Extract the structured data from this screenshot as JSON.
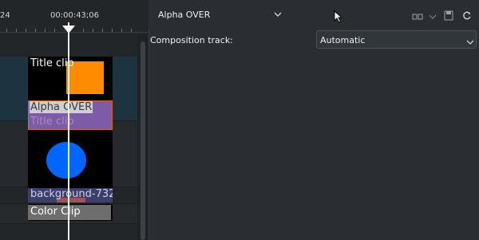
{
  "timeline": {
    "ruler_left": "24",
    "ruler_timecode": "00:00:43;06",
    "clips": {
      "title_top": "Title clip",
      "alpha_over": "Alpha OVER",
      "title_ghost": "Title clip",
      "background": "background-732",
      "color_clip": "Color Clip"
    }
  },
  "panel": {
    "header_title": "Alpha OVER",
    "composition_label": "Composition track:",
    "composition_value": "Automatic",
    "icons": [
      "compare-icon",
      "chevron-down-icon",
      "save-icon",
      "reset-icon"
    ]
  },
  "colors": {
    "accent_orange": "#ff8c00",
    "alpha_purple": "#7d5ba6",
    "circle_blue": "#0066ff",
    "cursor_white": "#f2f2f2"
  }
}
